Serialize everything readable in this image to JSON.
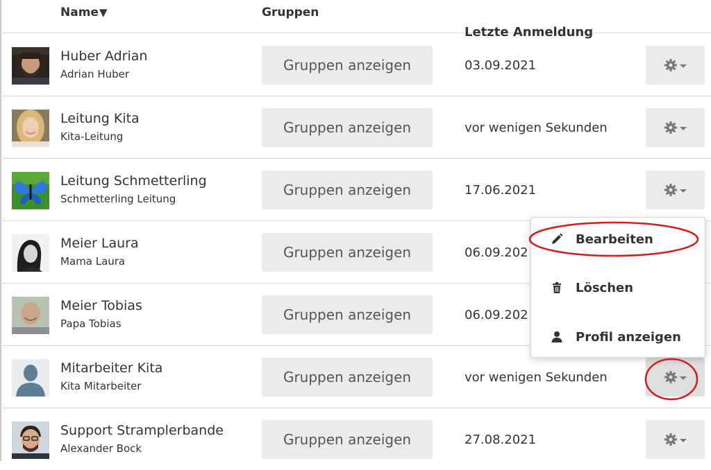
{
  "table": {
    "headers": {
      "name": "Name",
      "name_sort_indicator": "▼",
      "groups": "Gruppen",
      "last_login": "Letzte Anmeldung"
    },
    "rows": [
      {
        "name": "Huber Adrian",
        "subtitle": "Adrian Huber",
        "groups_button": "Gruppen anzeigen",
        "last_login": "03.09.2021",
        "avatar": "man-beard-photo"
      },
      {
        "name": "Leitung Kita",
        "subtitle": "Kita-Leitung",
        "groups_button": "Gruppen anzeigen",
        "last_login": "vor wenigen Sekunden",
        "avatar": "blonde-woman-photo"
      },
      {
        "name": "Leitung Schmetterling",
        "subtitle": "Schmetterling Leitung",
        "groups_button": "Gruppen anzeigen",
        "last_login": "17.06.2021",
        "avatar": "butterfly-photo"
      },
      {
        "name": "Meier Laura",
        "subtitle": "Mama Laura",
        "groups_button": "Gruppen anzeigen",
        "last_login": "06.09.202",
        "avatar": "woman-bw-photo"
      },
      {
        "name": "Meier Tobias",
        "subtitle": "Papa Tobias",
        "groups_button": "Gruppen anzeigen",
        "last_login": "06.09.202",
        "avatar": "bald-man-photo"
      },
      {
        "name": "Mitarbeiter Kita",
        "subtitle": "Kita Mitarbeiter",
        "groups_button": "Gruppen anzeigen",
        "last_login": "vor wenigen Sekunden",
        "avatar": "default-user-silhouette"
      },
      {
        "name": "Support Stramplerbande",
        "subtitle": "Alexander Bock",
        "groups_button": "Gruppen anzeigen",
        "last_login": "27.08.2021",
        "avatar": "man-glasses-photo"
      }
    ]
  },
  "dropdown_menu": {
    "items": [
      {
        "label": "Bearbeiten",
        "icon": "pencil-icon"
      },
      {
        "label": "Löschen",
        "icon": "trash-icon"
      },
      {
        "label": "Profil anzeigen",
        "icon": "user-icon"
      }
    ]
  },
  "colors": {
    "annotation": "#d01c1c",
    "button_bg": "#ebebeb",
    "divider": "#dcdcdc"
  }
}
